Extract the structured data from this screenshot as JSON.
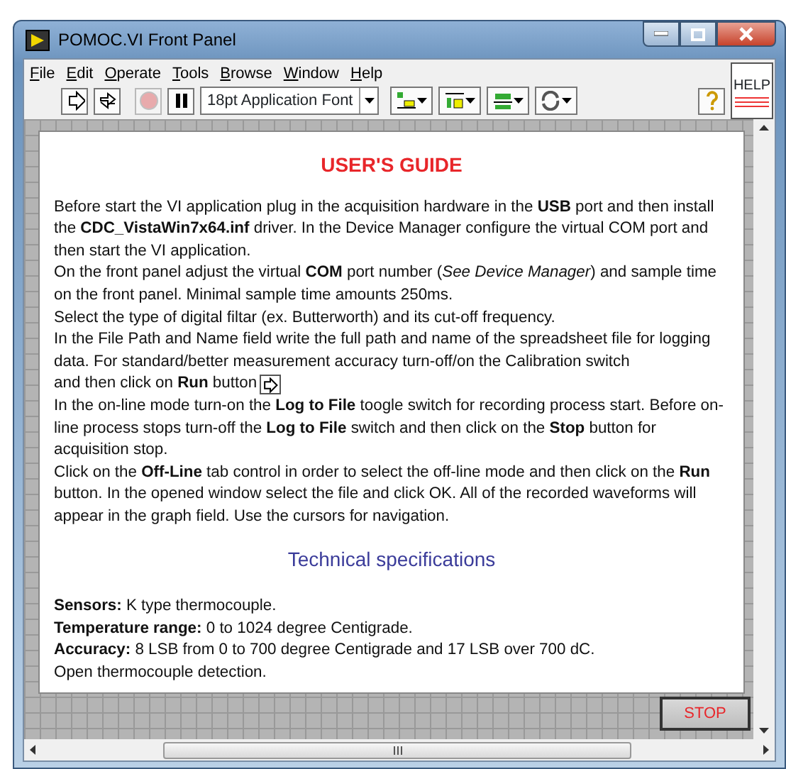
{
  "window": {
    "title": "POMOC.VI Front Panel"
  },
  "menu": [
    {
      "label": "File"
    },
    {
      "label": "Edit"
    },
    {
      "label": "Operate"
    },
    {
      "label": "Tools"
    },
    {
      "label": "Browse"
    },
    {
      "label": "Window"
    },
    {
      "label": "Help"
    }
  ],
  "toolbar": {
    "tools": [
      {
        "kind": "run",
        "disabled": false
      },
      {
        "kind": "run-continuous",
        "disabled": false
      },
      {
        "kind": "abort",
        "disabled": true
      },
      {
        "kind": "pause",
        "disabled": false
      }
    ],
    "font_menu": {
      "value": "18pt Application Font"
    },
    "arrange": [
      {
        "kind": "align"
      },
      {
        "kind": "distribute"
      },
      {
        "kind": "resize"
      },
      {
        "kind": "reorder"
      }
    ]
  },
  "help_panel": {
    "label": "HELP"
  },
  "guide": {
    "title": "USER'S GUIDE",
    "paragraphs": [
      {
        "kind": "text",
        "text": "Before start the VI application plug in the acquisition hardware in the **USB** port and then install the **CDC_VistaWin7x64.inf** driver. In the Device Manager configure the virtual COM port and then start the VI application."
      },
      {
        "kind": "text",
        "text": "On the front panel adjust the virtual **COM** port number (*See Device Manager*) and sample time on the front panel. Minimal sample time amounts 250ms."
      },
      {
        "kind": "text",
        "text": "Select the type of digital filtar (ex. Butterworth) and its cut-off frequency."
      },
      {
        "kind": "text",
        "text": "In the File Path and Name field write the full path and name of the spreadsheet file for logging data. For standard/better measurement accuracy turn-off/on the Calibration switch"
      },
      {
        "kind": "run-icon",
        "text": "and then click on **Run** button"
      },
      {
        "kind": "text",
        "text": "In the on-line mode turn-on the **Log to File** toogle switch for recording process start. Before on-line process stops turn-off the **Log to File** switch and then click on the **Stop** button for acquisition stop."
      },
      {
        "kind": "text",
        "text": "Click on the **Off-Line** tab control in order to select the off-line mode and then click on the **Run** button. In the opened window select the file and click OK. All of the recorded waveforms will appear in the graph field. Use the cursors for navigation."
      }
    ]
  },
  "specs": {
    "title": "Technical specifications",
    "lines": [
      "**Sensors:** K type thermocouple.",
      "**Temperature range:** 0 to 1024 degree Centigrade.",
      "**Accuracy:**  8 LSB from 0 to 700 degree Centigrade and 17 LSB over 700 dC.",
      "Open thermocouple detection."
    ]
  },
  "stop_button": {
    "label": "STOP"
  }
}
